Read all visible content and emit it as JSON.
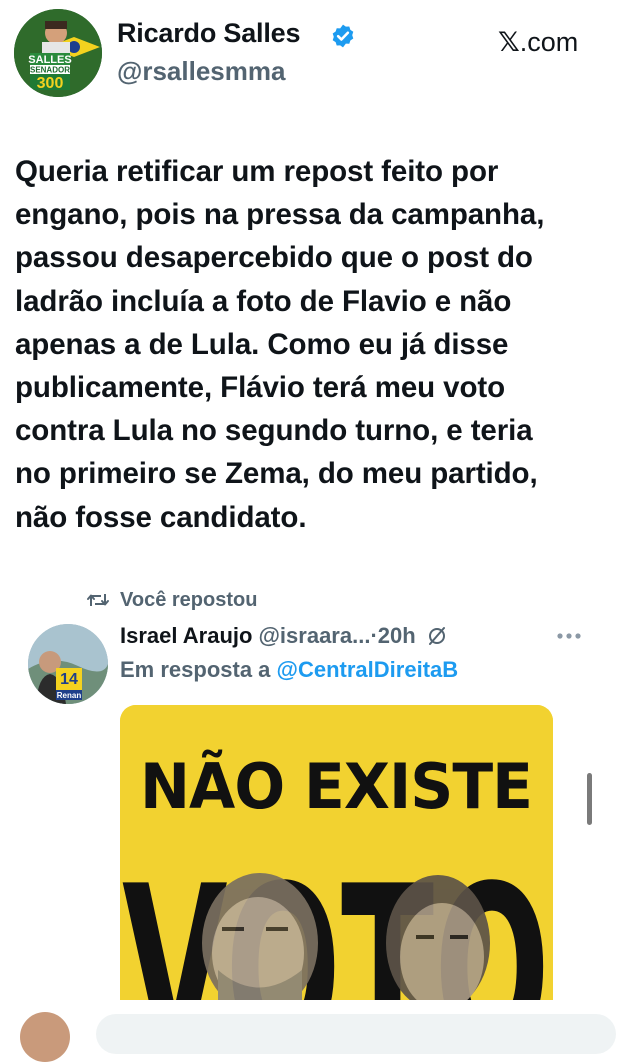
{
  "author": {
    "name": "Ricardo Salles",
    "handle": "@rsallesmma",
    "verified": true,
    "avatar_badge": [
      "SALLES",
      "SENADOR",
      "300"
    ]
  },
  "site": {
    "logo_glyph": "𝕏",
    "logo_suffix": ".com"
  },
  "tweet": {
    "text": "Queria retificar um repost feito por\nengano, pois na pressa da campanha,\npassou desapercebido que o post do\nladrão incluía a foto de Flavio e não\napenas a de Lula. Como eu já disse\npublicamente, Flávio terá meu voto\ncontra Lula no segundo turno, e teria\nno primeiro se Zema, do meu partido,\nnão fosse candidato."
  },
  "repost_indicator": {
    "label": "Você repostou"
  },
  "quoted": {
    "name": "Israel Araujo",
    "handle": "@israara...",
    "time": "·20h",
    "avatar_badge": [
      "14",
      "Renan"
    ],
    "reply_prefix": "Em resposta a",
    "reply_handle": "@CentralDireitaB",
    "media_headline": "NÃO EXISTE",
    "media_big_word": "VOTO"
  },
  "colors": {
    "text": "#0f1419",
    "muted": "#536471",
    "link": "#1d9bf0",
    "verified": "#1d9bf0",
    "media_yellow": "#f2d230"
  },
  "icons": [
    "verified-badge-icon",
    "repost-icon",
    "grok-icon",
    "more-icon"
  ]
}
